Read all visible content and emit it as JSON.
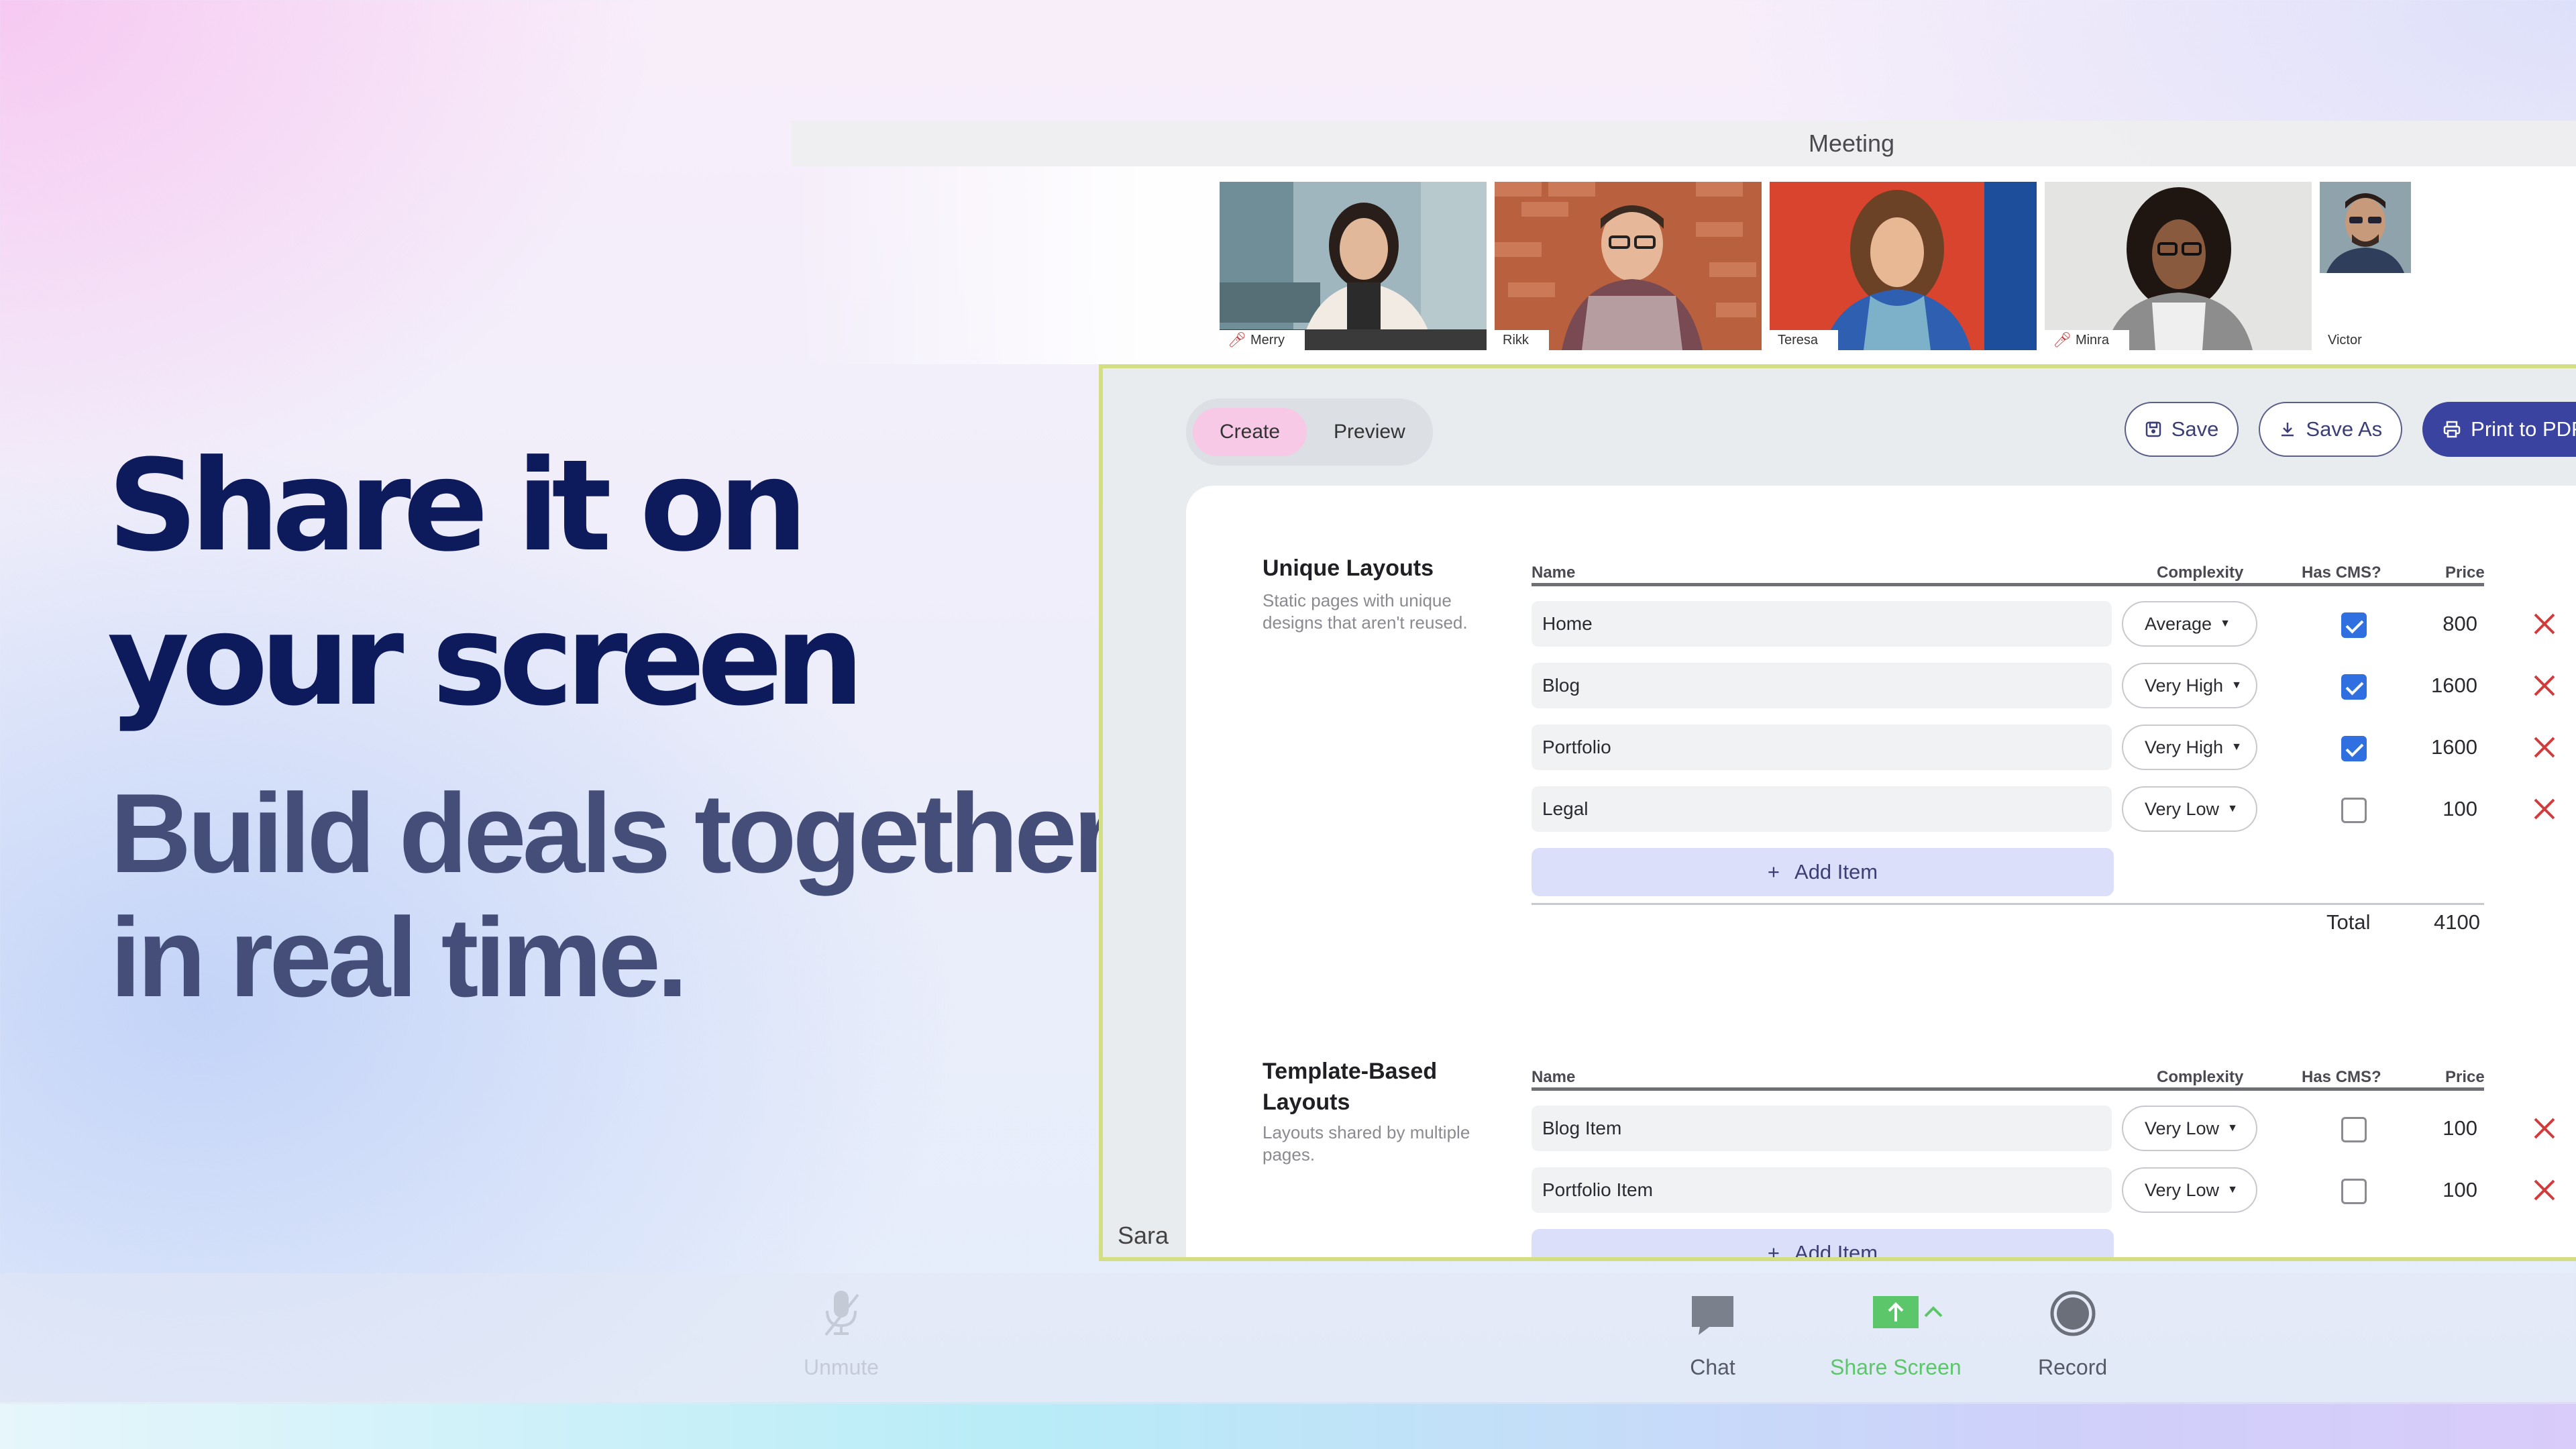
{
  "hero": {
    "line1": "Share it on",
    "line2": "your screen",
    "sub1": "Build deals together",
    "sub2": "in real time."
  },
  "meeting": {
    "title": "Meeting",
    "participants": [
      {
        "name": "Merry",
        "muted": true
      },
      {
        "name": "Rikk",
        "muted": false
      },
      {
        "name": "Teresa",
        "muted": false
      },
      {
        "name": "Minra",
        "muted": true
      },
      {
        "name": "Victor",
        "muted": false
      }
    ],
    "presenter": "Sara"
  },
  "app": {
    "tabs": [
      "Create",
      "Preview"
    ],
    "active_tab": "Create",
    "actions": {
      "save": "Save",
      "save_as": "Save As",
      "print": "Print to PDF"
    },
    "columns": {
      "name": "Name",
      "complexity": "Complexity",
      "has_cms": "Has CMS?",
      "price": "Price"
    },
    "add_item": "Add Item",
    "sections": [
      {
        "title": "Unique Layouts",
        "description": "Static pages with unique designs that aren't reused.",
        "rows": [
          {
            "name": "Home",
            "complexity": "Average",
            "has_cms": true,
            "price": "800"
          },
          {
            "name": "Blog",
            "complexity": "Very High",
            "has_cms": true,
            "price": "1600"
          },
          {
            "name": "Portfolio",
            "complexity": "Very High",
            "has_cms": true,
            "price": "1600"
          },
          {
            "name": "Legal",
            "complexity": "Very Low",
            "has_cms": false,
            "price": "100"
          }
        ],
        "total_label": "Total",
        "total": "4100"
      },
      {
        "title": "Template-Based Layouts",
        "description": "Layouts shared by multiple pages.",
        "rows": [
          {
            "name": "Blog Item",
            "complexity": "Very Low",
            "has_cms": false,
            "price": "100"
          },
          {
            "name": "Portfolio Item",
            "complexity": "Very Low",
            "has_cms": false,
            "price": "100"
          }
        ]
      }
    ]
  },
  "toolbar": {
    "unmute": "Unmute",
    "chat": "Chat",
    "share_screen": "Share Screen",
    "record": "Record"
  },
  "colors": {
    "hero": "#0d1a5c",
    "sub": "#454e78",
    "share_border": "#d4de82",
    "primary": "#3b43a0",
    "checkbox": "#2f6fe0",
    "delete": "#d23b3b",
    "share_green": "#5cc76a"
  }
}
